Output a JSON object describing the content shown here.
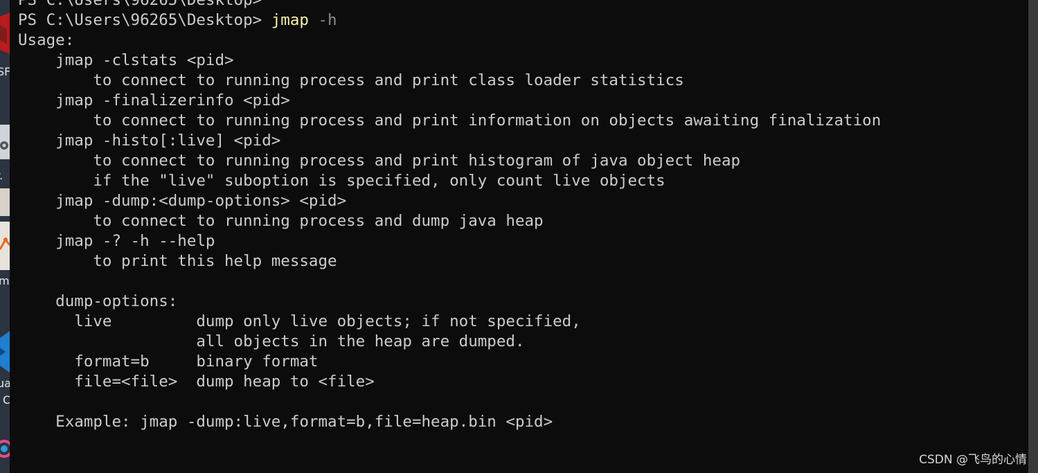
{
  "terminal": {
    "prompt": "PS C:\\Users\\96265\\Desktop>",
    "command": "jmap",
    "command_arg": "-h",
    "output_lines": [
      "Usage:",
      "    jmap -clstats <pid>",
      "        to connect to running process and print class loader statistics",
      "    jmap -finalizerinfo <pid>",
      "        to connect to running process and print information on objects awaiting finalization",
      "    jmap -histo[:live] <pid>",
      "        to connect to running process and print histogram of java object heap",
      "        if the \"live\" suboption is specified, only count live objects",
      "    jmap -dump:<dump-options> <pid>",
      "        to connect to running process and dump java heap",
      "    jmap -? -h --help",
      "        to print this help message",
      "",
      "    dump-options:",
      "      live         dump only live objects; if not specified,",
      "                   all objects in the heap are dumped.",
      "      format=b     binary format",
      "      file=<file>  dump heap to <file>",
      "",
      "    Example: jmap -dump:live,format=b,file=heap.bin <pid>"
    ]
  },
  "desktop": {
    "partial_labels": [
      "SF",
      "r.",
      "m",
      "ua",
      "C"
    ]
  },
  "watermark": "CSDN @飞鸟的心情",
  "colors": {
    "background": "#0c0c0c",
    "text": "#cccccc",
    "command": "#f9f1a5",
    "argument": "#8a8a8a"
  }
}
